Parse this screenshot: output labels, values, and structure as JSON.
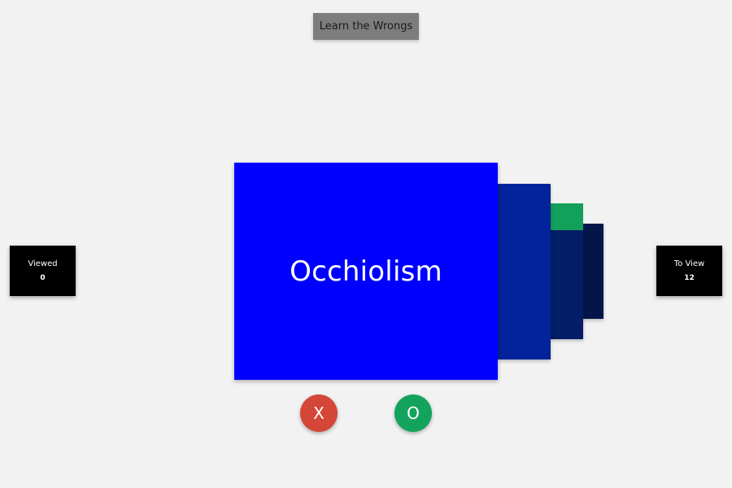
{
  "header": {
    "learn_button_label": "Learn the Wrongs"
  },
  "counters": {
    "viewed": {
      "label": "Viewed",
      "value": "0"
    },
    "to_view": {
      "label": "To View",
      "value": "12"
    }
  },
  "card": {
    "word": "Occhiolism"
  },
  "actions": {
    "wrong_label": "X",
    "right_label": "O"
  },
  "colors": {
    "background": "#f2f2f2",
    "card_main": "#0000fe",
    "wrong_button": "#d44637",
    "right_button": "#14a35d",
    "counter_box": "#000000",
    "learn_button": "#7d7d7d"
  }
}
